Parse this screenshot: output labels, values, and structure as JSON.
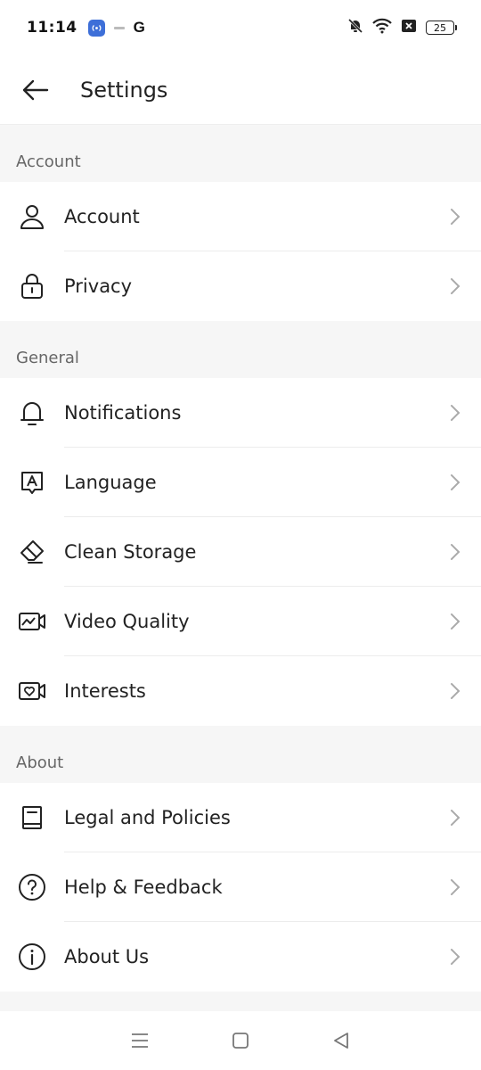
{
  "status_bar": {
    "time": "11:14",
    "g_label": "G",
    "battery": "25"
  },
  "header": {
    "title": "Settings"
  },
  "sections": [
    {
      "title": "Account",
      "items": [
        {
          "label": "Account",
          "icon": "person-icon"
        },
        {
          "label": "Privacy",
          "icon": "lock-icon"
        }
      ]
    },
    {
      "title": "General",
      "items": [
        {
          "label": "Notifications",
          "icon": "bell-icon"
        },
        {
          "label": "Language",
          "icon": "language-icon"
        },
        {
          "label": "Clean Storage",
          "icon": "eraser-icon"
        },
        {
          "label": "Video Quality",
          "icon": "video-quality-icon"
        },
        {
          "label": "Interests",
          "icon": "interests-icon"
        }
      ]
    },
    {
      "title": "About",
      "items": [
        {
          "label": "Legal and Policies",
          "icon": "book-icon"
        },
        {
          "label": "Help & Feedback",
          "icon": "help-icon"
        },
        {
          "label": "About Us",
          "icon": "info-icon"
        }
      ]
    }
  ],
  "nav": [
    "menu-icon",
    "home-icon",
    "back-triangle-icon"
  ]
}
